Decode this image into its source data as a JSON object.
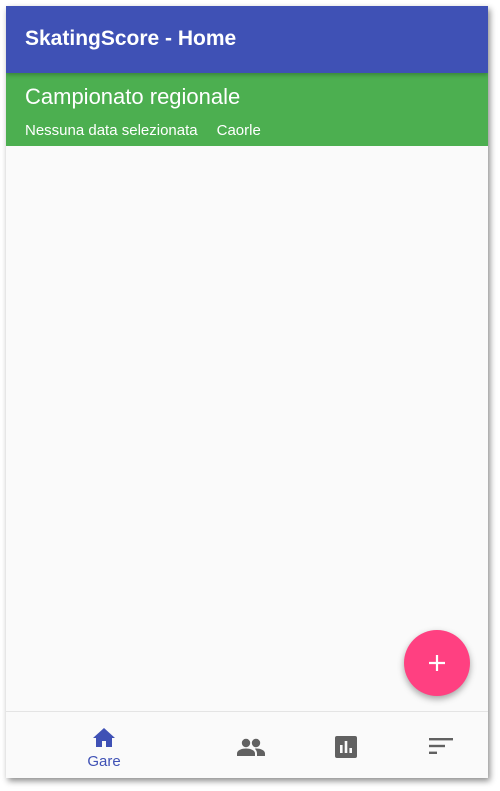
{
  "appbar": {
    "title": "SkatingScore - Home",
    "color": "#3f51b5"
  },
  "event": {
    "title": "Campionato regionale",
    "date": "Nessuna data selezionata",
    "location": "Caorle",
    "color": "#4caf50"
  },
  "fab": {
    "icon": "plus-icon",
    "color": "#ff4081"
  },
  "bottom_nav": {
    "items": [
      {
        "icon": "home-icon",
        "label": "Gare",
        "active": true
      },
      {
        "icon": "people-icon",
        "label": "",
        "active": false
      },
      {
        "icon": "bar-chart-icon",
        "label": "",
        "active": false
      },
      {
        "icon": "sort-icon",
        "label": "",
        "active": false
      }
    ],
    "active_color": "#3f51b5",
    "inactive_color": "#616161"
  }
}
